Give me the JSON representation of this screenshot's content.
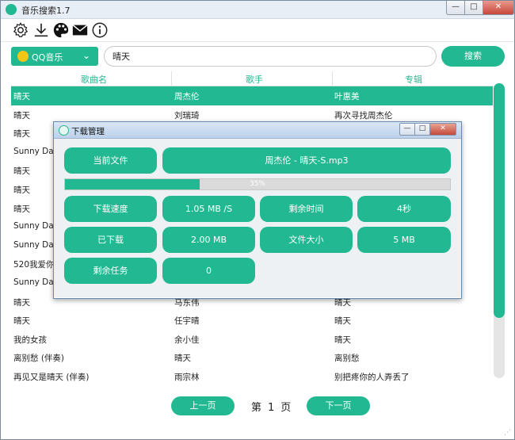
{
  "window": {
    "title": "音乐搜索1.7",
    "min": "—",
    "max": "□",
    "close": "✕"
  },
  "toolbar": {
    "icons": [
      "gear-icon",
      "download-icon",
      "palette-icon",
      "mail-icon",
      "info-icon"
    ]
  },
  "search": {
    "source": "QQ音乐",
    "query": "晴天",
    "button": "搜索"
  },
  "table": {
    "columns": [
      "歌曲名",
      "歌手",
      "专辑"
    ],
    "rows": [
      [
        "晴天",
        "周杰伦",
        "叶惠美"
      ],
      [
        "晴天",
        "刘瑞琦",
        "再次寻找周杰伦"
      ],
      [
        "晴天",
        "",
        ""
      ],
      [
        "Sunny Day",
        "",
        ""
      ],
      [
        "晴天",
        "",
        ""
      ],
      [
        "晴天",
        "",
        ""
      ],
      [
        "晴天",
        "",
        ""
      ],
      [
        "Sunny Day",
        "",
        ""
      ],
      [
        "Sunny Day",
        "",
        ""
      ],
      [
        "520我爱你",
        "",
        ""
      ],
      [
        "Sunny Day",
        "",
        ""
      ],
      [
        "晴天",
        "马东伟",
        "晴天"
      ],
      [
        "晴天",
        "任宇晴",
        "晴天"
      ],
      [
        "我的女孩",
        "余小佳",
        "晴天"
      ],
      [
        "离别愁 (伴奏)",
        "晴天",
        "离别愁"
      ],
      [
        "再见又是晴天 (伴奏)",
        "雨宗林",
        "别把疼你的人弄丢了"
      ]
    ],
    "selected_row": 0
  },
  "pager": {
    "prev": "上一页",
    "next": "下一页",
    "word1": "第",
    "page": "1",
    "word2": "页"
  },
  "dialog": {
    "title": "下载管理",
    "current_file_label": "当前文件",
    "current_file": "周杰伦 - 晴天-S.mp3",
    "progress_percent": 35,
    "progress_text": "35%",
    "speed_label": "下载速度",
    "speed": "1.05 MB /S",
    "remaining_label": "剩余时间",
    "remaining": "4秒",
    "downloaded_label": "已下载",
    "downloaded": "2.00 MB",
    "size_label": "文件大小",
    "size": "5 MB",
    "tasks_label": "剩余任务",
    "tasks": "0"
  },
  "colors": {
    "accent": "#22b892"
  }
}
